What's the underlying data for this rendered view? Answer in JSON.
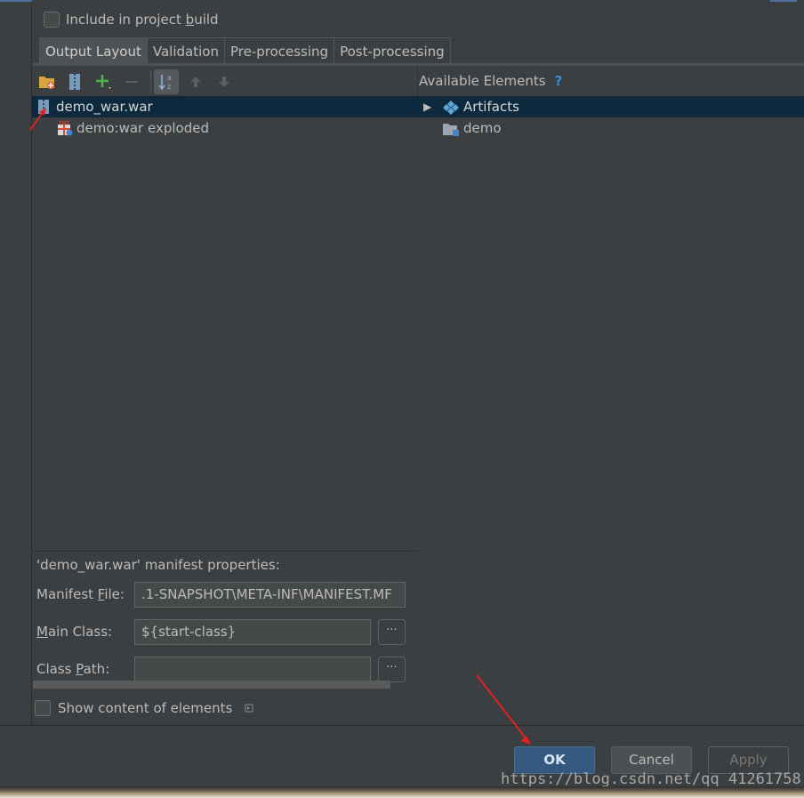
{
  "include_checkbox": {
    "label_pre": "Include in project ",
    "label_mnemonic": "b",
    "label_post": "uild"
  },
  "tabs": [
    {
      "label": "Output Layout"
    },
    {
      "label": "Validation"
    },
    {
      "label": "Pre-processing"
    },
    {
      "label": "Post-processing"
    }
  ],
  "toolbar": {
    "icons": [
      "folder-add-icon",
      "archive-icon",
      "plus-icon",
      "minus-icon",
      "sort-az-icon",
      "arrow-up-icon",
      "arrow-down-icon"
    ]
  },
  "left_tree": {
    "items": [
      {
        "label": "demo_war.war",
        "icon": "war-archive-icon",
        "selected": true
      },
      {
        "label": "demo:war exploded",
        "icon": "gift-icon",
        "selected": false
      }
    ]
  },
  "available": {
    "title": "Available Elements",
    "help": "?",
    "items": [
      {
        "label": "Artifacts",
        "expander": "▶",
        "icon": "artifacts-icon",
        "selected": true
      },
      {
        "label": "demo",
        "icon": "module-folder-icon",
        "selected": false
      }
    ]
  },
  "manifest": {
    "title": "'demo_war.war' manifest properties:",
    "file_label_pre": "Manifest ",
    "file_label_mnemonic": "F",
    "file_label_post": "ile:",
    "file_value": ".1-SNAPSHOT\\META-INF\\MANIFEST.MF",
    "main_label_mnemonic": "M",
    "main_label_post": "ain Class:",
    "main_value": "${start-class}",
    "path_label_pre": "Class ",
    "path_label_mnemonic": "P",
    "path_label_post": "ath:",
    "path_value": "",
    "browse": "···"
  },
  "show_content": {
    "label": "Show content of elements"
  },
  "buttons": {
    "ok": "OK",
    "cancel": "Cancel",
    "apply": "Apply"
  },
  "watermark": "https://blog.csdn.net/qq_41261758",
  "colors": {
    "selection": "#0d293e",
    "ok_button": "#365880",
    "annotation_arrow": "#e02020"
  }
}
